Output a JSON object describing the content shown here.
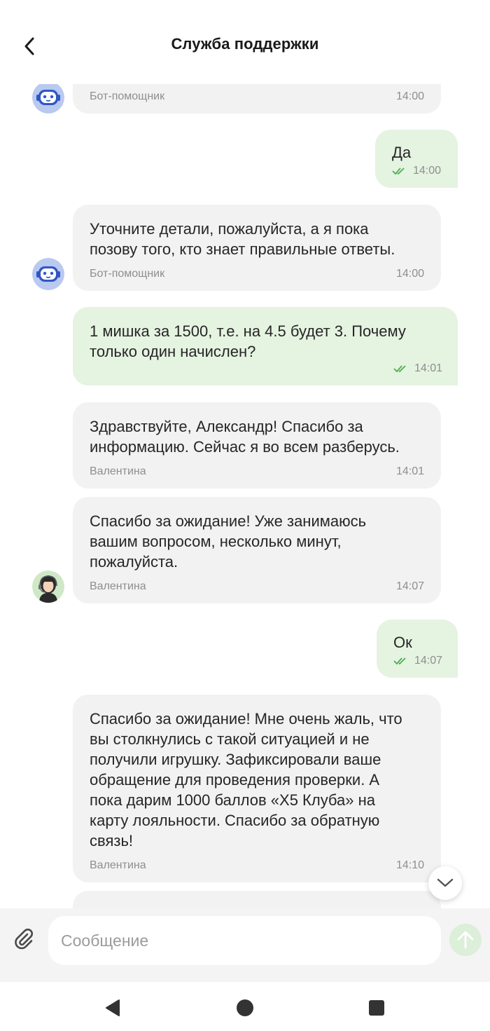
{
  "header": {
    "title": "Служба поддержки"
  },
  "icons": {
    "back": "chevron-left-icon",
    "attach": "paperclip-icon",
    "send": "arrow-up-icon",
    "scroll_down": "chevron-down-icon",
    "read": "double-check-icon"
  },
  "messages": [
    {
      "direction": "in",
      "text": "",
      "author": "Бот-помощник",
      "time": "14:00"
    },
    {
      "direction": "out",
      "text": "Да",
      "time": "14:00"
    },
    {
      "direction": "in",
      "text": "Уточните детали, пожалуйста, а я пока\nпозову того, кто знает правильные ответы.",
      "author": "Бот-помощник",
      "time": "14:00"
    },
    {
      "direction": "out",
      "text": "1 мишка за 1500, т.е. на 4.5 будет 3. Почему\nтолько один начислен?",
      "time": "14:01"
    },
    {
      "direction": "in",
      "text": "Здравствуйте, Александр! Спасибо за\nинформацию. Сейчас я во всем разберусь.",
      "author": "Валентина",
      "time": "14:01"
    },
    {
      "direction": "in",
      "text": "Спасибо за ожидание! Уже занимаюсь\nвашим вопросом, несколько минут,\nпожалуйста.",
      "author": "Валентина",
      "time": "14:07"
    },
    {
      "direction": "out",
      "text": "Ок",
      "time": "14:07"
    },
    {
      "direction": "in",
      "text": "Спасибо за ожидание! Мне очень жаль, что\nвы столкнулись с такой ситуацией и не\nполучили игрушку. Зафиксировали ваше\nобращение для проведения проверки. А\nпока дарим 1000 баллов «X5 Клуба» на\nкарту лояльности. Спасибо за обратную\nсвязь!",
      "author": "Валентина",
      "time": "14:10"
    }
  ],
  "composer": {
    "placeholder": "Сообщение"
  },
  "colors": {
    "incoming_bubble": "#f2f2f2",
    "outgoing_bubble": "#e5f3e1",
    "read_check": "#4caf50",
    "send_button": "#dcefd9"
  }
}
